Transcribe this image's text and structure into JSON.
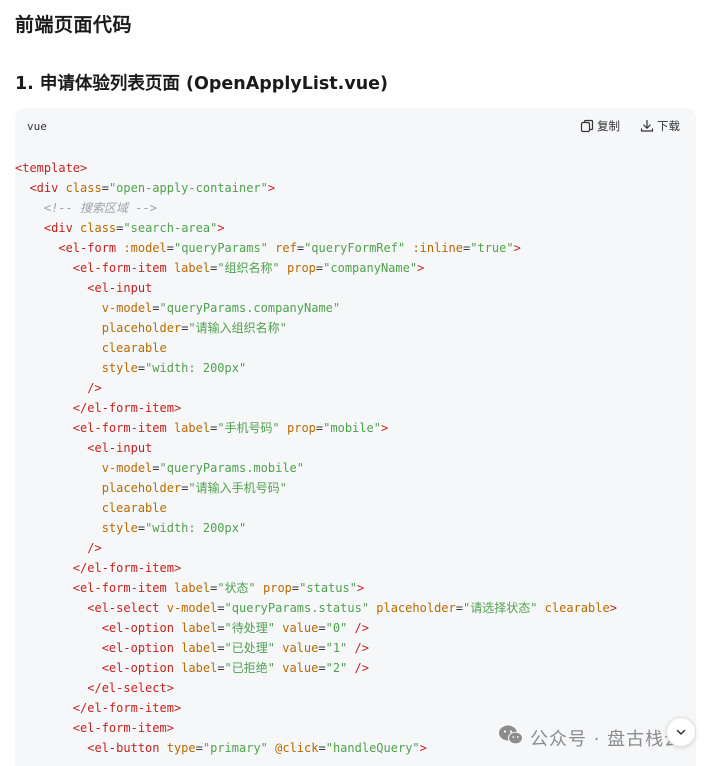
{
  "headings": {
    "section_title": "前端页面代码",
    "subsection_title": "1. 申请体验列表页面 (OpenApplyList.vue)"
  },
  "code_block": {
    "language": "vue",
    "copy_label": "复制",
    "download_label": "下载",
    "lines": [
      [
        [
          "t",
          "<template"
        ],
        [
          "t",
          ">"
        ]
      ],
      [
        [
          "p",
          "  "
        ],
        [
          "t",
          "<div "
        ],
        [
          "a",
          "class"
        ],
        [
          "p",
          "="
        ],
        [
          "v",
          "\"open-apply-container\""
        ],
        [
          "t",
          ">"
        ]
      ],
      [
        [
          "p",
          "    "
        ],
        [
          "c",
          "<!-- 搜索区域 -->"
        ]
      ],
      [
        [
          "p",
          "    "
        ],
        [
          "t",
          "<div "
        ],
        [
          "a",
          "class"
        ],
        [
          "p",
          "="
        ],
        [
          "v",
          "\"search-area\""
        ],
        [
          "t",
          ">"
        ]
      ],
      [
        [
          "p",
          "      "
        ],
        [
          "t",
          "<el-form "
        ],
        [
          "a",
          ":model"
        ],
        [
          "p",
          "="
        ],
        [
          "v",
          "\"queryParams\" "
        ],
        [
          "a",
          "ref"
        ],
        [
          "p",
          "="
        ],
        [
          "v",
          "\"queryFormRef\" "
        ],
        [
          "a",
          ":inline"
        ],
        [
          "p",
          "="
        ],
        [
          "v",
          "\"true\""
        ],
        [
          "t",
          ">"
        ]
      ],
      [
        [
          "p",
          "        "
        ],
        [
          "t",
          "<el-form-item "
        ],
        [
          "a",
          "label"
        ],
        [
          "p",
          "="
        ],
        [
          "v",
          "\"组织名称\" "
        ],
        [
          "a",
          "prop"
        ],
        [
          "p",
          "="
        ],
        [
          "v",
          "\"companyName\""
        ],
        [
          "t",
          ">"
        ]
      ],
      [
        [
          "p",
          "          "
        ],
        [
          "t",
          "<el-input"
        ]
      ],
      [
        [
          "p",
          "            "
        ],
        [
          "a",
          "v-model"
        ],
        [
          "p",
          "="
        ],
        [
          "v",
          "\"queryParams.companyName\""
        ]
      ],
      [
        [
          "p",
          "            "
        ],
        [
          "a",
          "placeholder"
        ],
        [
          "p",
          "="
        ],
        [
          "v",
          "\"请输入组织名称\""
        ]
      ],
      [
        [
          "p",
          "            "
        ],
        [
          "a",
          "clearable"
        ]
      ],
      [
        [
          "p",
          "            "
        ],
        [
          "a",
          "style"
        ],
        [
          "p",
          "="
        ],
        [
          "v",
          "\"width: 200px\""
        ]
      ],
      [
        [
          "p",
          "          "
        ],
        [
          "t",
          "/>"
        ]
      ],
      [
        [
          "p",
          "        "
        ],
        [
          "t",
          "</el-form-item>"
        ]
      ],
      [
        [
          "p",
          "        "
        ],
        [
          "t",
          "<el-form-item "
        ],
        [
          "a",
          "label"
        ],
        [
          "p",
          "="
        ],
        [
          "v",
          "\"手机号码\" "
        ],
        [
          "a",
          "prop"
        ],
        [
          "p",
          "="
        ],
        [
          "v",
          "\"mobile\""
        ],
        [
          "t",
          ">"
        ]
      ],
      [
        [
          "p",
          "          "
        ],
        [
          "t",
          "<el-input"
        ]
      ],
      [
        [
          "p",
          "            "
        ],
        [
          "a",
          "v-model"
        ],
        [
          "p",
          "="
        ],
        [
          "v",
          "\"queryParams.mobile\""
        ]
      ],
      [
        [
          "p",
          "            "
        ],
        [
          "a",
          "placeholder"
        ],
        [
          "p",
          "="
        ],
        [
          "v",
          "\"请输入手机号码\""
        ]
      ],
      [
        [
          "p",
          "            "
        ],
        [
          "a",
          "clearable"
        ]
      ],
      [
        [
          "p",
          "            "
        ],
        [
          "a",
          "style"
        ],
        [
          "p",
          "="
        ],
        [
          "v",
          "\"width: 200px\""
        ]
      ],
      [
        [
          "p",
          "          "
        ],
        [
          "t",
          "/>"
        ]
      ],
      [
        [
          "p",
          "        "
        ],
        [
          "t",
          "</el-form-item>"
        ]
      ],
      [
        [
          "p",
          "        "
        ],
        [
          "t",
          "<el-form-item "
        ],
        [
          "a",
          "label"
        ],
        [
          "p",
          "="
        ],
        [
          "v",
          "\"状态\" "
        ],
        [
          "a",
          "prop"
        ],
        [
          "p",
          "="
        ],
        [
          "v",
          "\"status\""
        ],
        [
          "t",
          ">"
        ]
      ],
      [
        [
          "p",
          "          "
        ],
        [
          "t",
          "<el-select "
        ],
        [
          "a",
          "v-model"
        ],
        [
          "p",
          "="
        ],
        [
          "v",
          "\"queryParams.status\" "
        ],
        [
          "a",
          "placeholder"
        ],
        [
          "p",
          "="
        ],
        [
          "v",
          "\"请选择状态\" "
        ],
        [
          "a",
          "clearable"
        ],
        [
          "t",
          ">"
        ]
      ],
      [
        [
          "p",
          "            "
        ],
        [
          "t",
          "<el-option "
        ],
        [
          "a",
          "label"
        ],
        [
          "p",
          "="
        ],
        [
          "v",
          "\"待处理\" "
        ],
        [
          "a",
          "value"
        ],
        [
          "p",
          "="
        ],
        [
          "v",
          "\"0\" "
        ],
        [
          "t",
          "/>"
        ]
      ],
      [
        [
          "p",
          "            "
        ],
        [
          "t",
          "<el-option "
        ],
        [
          "a",
          "label"
        ],
        [
          "p",
          "="
        ],
        [
          "v",
          "\"已处理\" "
        ],
        [
          "a",
          "value"
        ],
        [
          "p",
          "="
        ],
        [
          "v",
          "\"1\" "
        ],
        [
          "t",
          "/>"
        ]
      ],
      [
        [
          "p",
          "            "
        ],
        [
          "t",
          "<el-option "
        ],
        [
          "a",
          "label"
        ],
        [
          "p",
          "="
        ],
        [
          "v",
          "\"已拒绝\" "
        ],
        [
          "a",
          "value"
        ],
        [
          "p",
          "="
        ],
        [
          "v",
          "\"2\" "
        ],
        [
          "t",
          "/>"
        ]
      ],
      [
        [
          "p",
          "          "
        ],
        [
          "t",
          "</el-select>"
        ]
      ],
      [
        [
          "p",
          "        "
        ],
        [
          "t",
          "</el-form-item>"
        ]
      ],
      [
        [
          "p",
          "        "
        ],
        [
          "t",
          "<el-form-item"
        ],
        [
          "t",
          ">"
        ]
      ],
      [
        [
          "p",
          "          "
        ],
        [
          "t",
          "<el-button "
        ],
        [
          "a",
          "type"
        ],
        [
          "p",
          "="
        ],
        [
          "v",
          "\"primary\" "
        ],
        [
          "a",
          "@click"
        ],
        [
          "p",
          "="
        ],
        [
          "v",
          "\"handleQuery\""
        ],
        [
          "t",
          ">"
        ]
      ]
    ]
  },
  "watermark": {
    "text": "公众号 · 盘古栈云",
    "icon": "wechat-icon"
  },
  "scroll_button": {
    "icon": "chevron-down-icon"
  },
  "colors": {
    "tag": "#c5221f",
    "attribute": "#b76b01",
    "string": "#50a14f",
    "comment": "#a0a1a7",
    "code_background": "#f6f7f9"
  }
}
